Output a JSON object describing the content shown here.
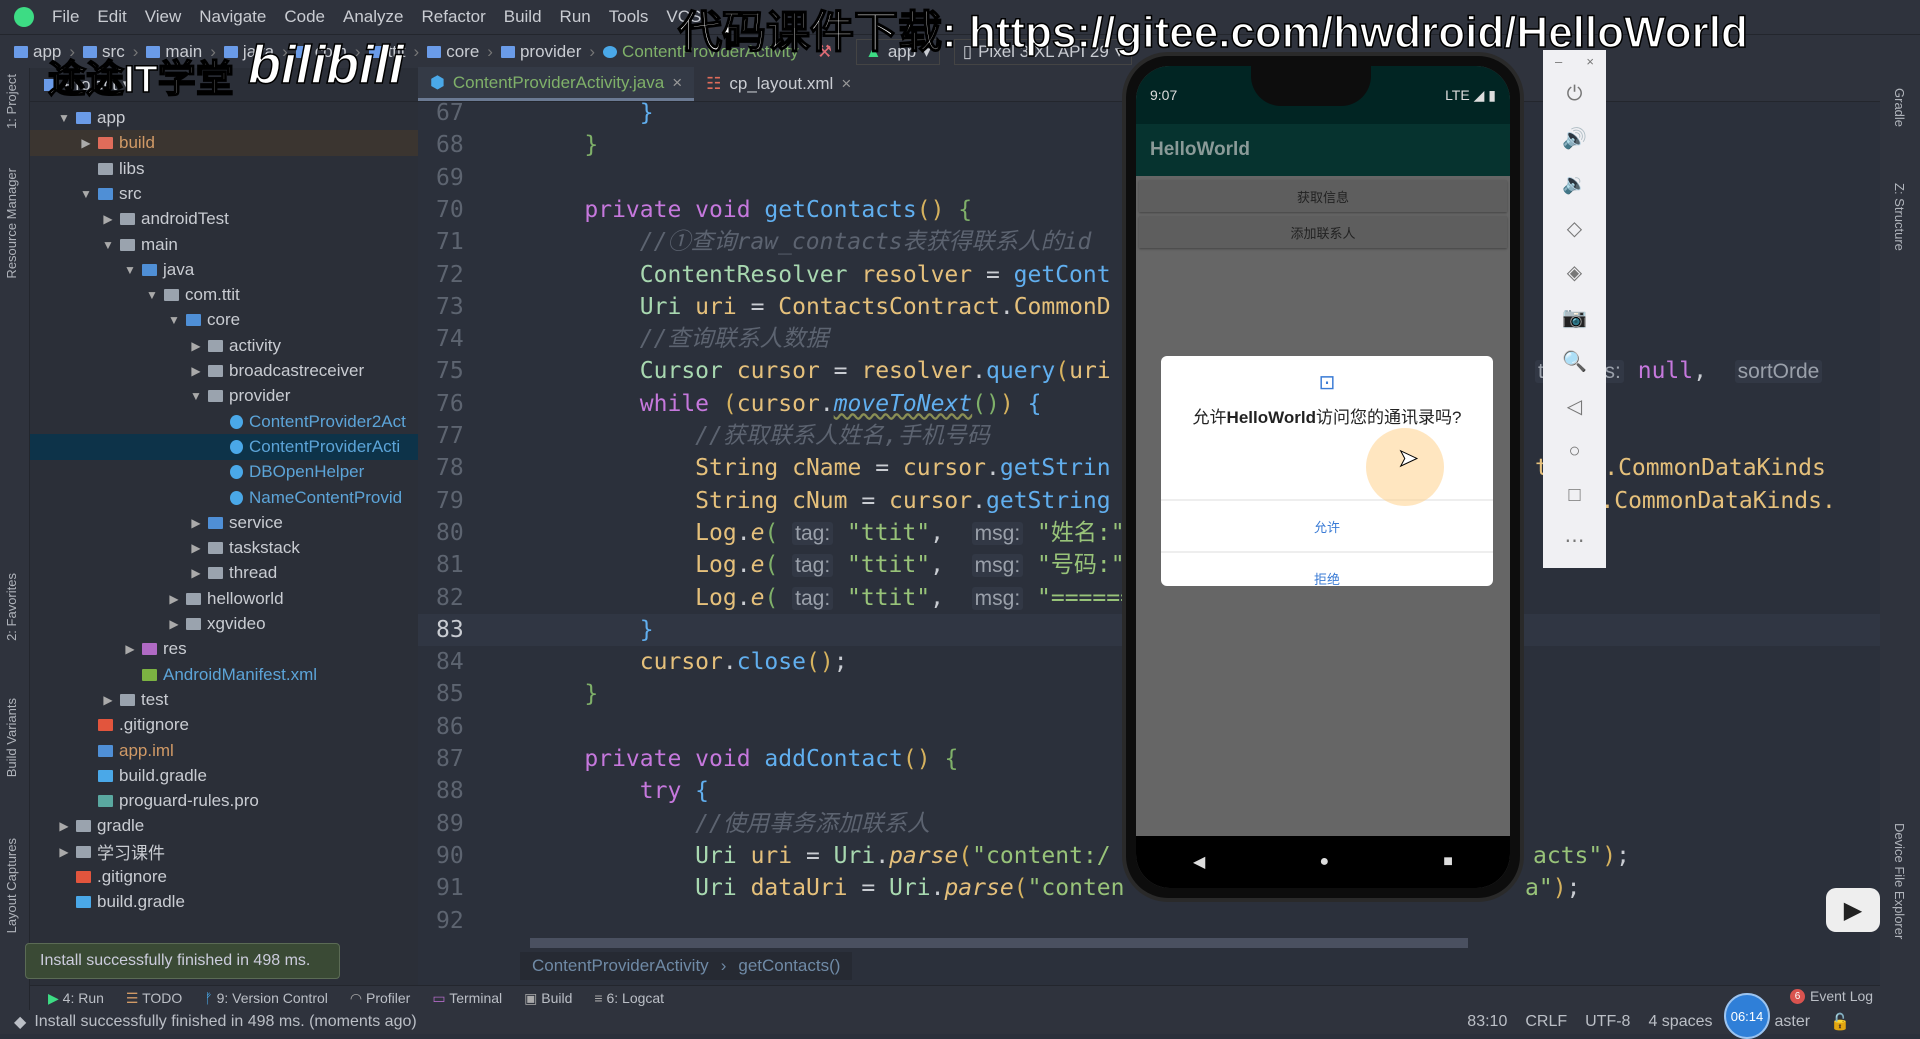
{
  "watermark": {
    "top": "代码课件下载: https://gitee.com/hwdroid/HelloWorld",
    "channel": "途途IT学堂",
    "logo": "bilibili"
  },
  "menu": [
    "File",
    "Edit",
    "View",
    "Navigate",
    "Code",
    "Analyze",
    "Refactor",
    "Build",
    "Run",
    "Tools",
    "VCS"
  ],
  "breadcrumbs": [
    "app",
    "src",
    "main",
    "java",
    "com",
    "ttit",
    "core",
    "provider",
    "ContentProviderActivity"
  ],
  "run_config": "app",
  "device": "Pixel 3 XL API 29",
  "left_strip": [
    "1: Project",
    "Resource Manager",
    "2: Favorites",
    "Build Variants",
    "Layout Captures"
  ],
  "right_strip": [
    "Gradle",
    "Z: Structure",
    "Device File Explorer"
  ],
  "project": {
    "header": "Project",
    "tree": [
      {
        "l": 1,
        "t": "app",
        "o": true,
        "k": "module"
      },
      {
        "l": 2,
        "t": "build",
        "k": "fold-orange",
        "c": "#d19a66",
        "bg": "#3b3530"
      },
      {
        "l": 2,
        "t": "libs",
        "k": "folder",
        "leaf": true
      },
      {
        "l": 2,
        "t": "src",
        "o": true,
        "k": "src"
      },
      {
        "l": 3,
        "t": "androidTest",
        "k": "folder"
      },
      {
        "l": 3,
        "t": "main",
        "o": true,
        "k": "folder"
      },
      {
        "l": 4,
        "t": "java",
        "o": true,
        "k": "src"
      },
      {
        "l": 5,
        "t": "com.ttit",
        "o": true,
        "k": "package"
      },
      {
        "l": 6,
        "t": "core",
        "o": true,
        "k": "src"
      },
      {
        "l": 7,
        "t": "activity",
        "k": "package"
      },
      {
        "l": 7,
        "t": "broadcastreceiver",
        "k": "package"
      },
      {
        "l": 7,
        "t": "provider",
        "o": true,
        "k": "package"
      },
      {
        "l": 8,
        "t": "ContentProvider2Act",
        "k": "file",
        "c": "#5ca4d8",
        "leaf": true
      },
      {
        "l": 8,
        "t": "ContentProviderActi",
        "k": "file",
        "c": "#5ca4d8",
        "leaf": true,
        "bg": "#0d3349"
      },
      {
        "l": 8,
        "t": "DBOpenHelper",
        "k": "file",
        "c": "#5ca4d8",
        "leaf": true
      },
      {
        "l": 8,
        "t": "NameContentProvid",
        "k": "file",
        "c": "#5ca4d8",
        "leaf": true
      },
      {
        "l": 7,
        "t": "service",
        "k": "src"
      },
      {
        "l": 7,
        "t": "taskstack",
        "k": "package"
      },
      {
        "l": 7,
        "t": "thread",
        "k": "package"
      },
      {
        "l": 6,
        "t": "helloworld",
        "k": "package"
      },
      {
        "l": 6,
        "t": "xgvideo",
        "k": "package"
      },
      {
        "l": 4,
        "t": "res",
        "k": "res"
      },
      {
        "l": 4,
        "t": "AndroidManifest.xml",
        "k": "android",
        "c": "#5ca4d8",
        "leaf": true
      },
      {
        "l": 3,
        "t": "test",
        "k": "folder"
      },
      {
        "l": 2,
        "t": ".gitignore",
        "k": "git",
        "leaf": true
      },
      {
        "l": 2,
        "t": "app.iml",
        "k": "iml",
        "c": "#d19a66",
        "leaf": true
      },
      {
        "l": 2,
        "t": "build.gradle",
        "k": "gradle",
        "leaf": true
      },
      {
        "l": 2,
        "t": "proguard-rules.pro",
        "k": "pro",
        "leaf": true
      },
      {
        "l": 1,
        "t": "gradle",
        "k": "folder"
      },
      {
        "l": 1,
        "t": "学习课件",
        "k": "folder"
      },
      {
        "l": 1,
        "t": ".gitignore",
        "k": "git",
        "leaf": true
      },
      {
        "l": 1,
        "t": "build.gradle",
        "k": "gradle",
        "leaf": true
      }
    ]
  },
  "tabs": [
    {
      "label": "ContentProviderActivity.java",
      "active": true
    },
    {
      "label": "cp_layout.xml"
    }
  ],
  "code": {
    "current_line": 83,
    "lines": [
      {
        "n": 67,
        "tk": [
          [
            "pl",
            "        "
          ],
          [
            "bl",
            "}"
          ]
        ]
      },
      {
        "n": 68,
        "tk": [
          [
            "pl",
            "    "
          ],
          [
            "gr",
            "}"
          ]
        ]
      },
      {
        "n": 69,
        "tk": []
      },
      {
        "n": 70,
        "tk": [
          [
            "pl",
            "    "
          ],
          [
            "kw",
            "private void "
          ],
          [
            "fn",
            "getContacts"
          ],
          [
            "ye",
            "()"
          ],
          [
            "pl",
            " "
          ],
          [
            "gr",
            "{"
          ]
        ]
      },
      {
        "n": 71,
        "tk": [
          [
            "pl",
            "        "
          ],
          [
            "cm",
            "//①查询raw_contacts表获得联系人的id"
          ]
        ]
      },
      {
        "n": 72,
        "tk": [
          [
            "pl",
            "        "
          ],
          [
            "ty",
            "ContentResolver "
          ],
          [
            "va",
            "resolver"
          ],
          [
            "pl",
            " = "
          ],
          [
            "fn",
            "getCont"
          ]
        ]
      },
      {
        "n": 73,
        "tk": [
          [
            "pl",
            "        "
          ],
          [
            "ty",
            "Uri "
          ],
          [
            "va",
            "uri"
          ],
          [
            "pl",
            " = "
          ],
          [
            "va",
            "ContactsContract"
          ],
          [
            "pl",
            "."
          ],
          [
            "va",
            "CommonD"
          ]
        ]
      },
      {
        "n": 74,
        "tk": [
          [
            "pl",
            "        "
          ],
          [
            "cm",
            "//查询联系人数据"
          ]
        ]
      },
      {
        "n": 75,
        "tk": [
          [
            "pl",
            "        "
          ],
          [
            "ty",
            "Cursor "
          ],
          [
            "va",
            "cursor"
          ],
          [
            "pl",
            " = "
          ],
          [
            "va",
            "resolver"
          ],
          [
            "pl",
            "."
          ],
          [
            "fn",
            "query"
          ],
          [
            "ye",
            "("
          ],
          [
            "va",
            "uri"
          ]
        ]
      },
      {
        "n": 76,
        "tk": [
          [
            "pl",
            "        "
          ],
          [
            "kw",
            "while "
          ],
          [
            "ye",
            "("
          ],
          [
            "va",
            "cursor"
          ],
          [
            "pl",
            "."
          ],
          [
            "fn it ul",
            "moveToNext"
          ],
          [
            "gr",
            "()"
          ],
          [
            "ye",
            ")"
          ],
          [
            "pl",
            " "
          ],
          [
            "bl",
            "{"
          ]
        ]
      },
      {
        "n": 77,
        "tk": [
          [
            "pl",
            "            "
          ],
          [
            "cm",
            "//获取联系人姓名,手机号码"
          ]
        ]
      },
      {
        "n": 78,
        "tk": [
          [
            "pl",
            "            "
          ],
          [
            "va",
            "String cName"
          ],
          [
            "pl",
            " = "
          ],
          [
            "va",
            "cursor"
          ],
          [
            "pl",
            "."
          ],
          [
            "fn",
            "getStrin"
          ]
        ]
      },
      {
        "n": 79,
        "tk": [
          [
            "pl",
            "            "
          ],
          [
            "va",
            "String cNum"
          ],
          [
            "pl",
            " = "
          ],
          [
            "va",
            "cursor"
          ],
          [
            "pl",
            "."
          ],
          [
            "fn",
            "getString"
          ]
        ]
      },
      {
        "n": 80,
        "tk": [
          [
            "pl",
            "            "
          ],
          [
            "va",
            "Log"
          ],
          [
            "pl",
            "."
          ],
          [
            "va it",
            "e"
          ],
          [
            "gr",
            "( "
          ],
          [
            "hint",
            "tag:"
          ],
          [
            "st",
            " \"ttit\""
          ],
          [
            "pl",
            ",  "
          ],
          [
            "hint",
            "msg:"
          ],
          [
            "st",
            " \"姓名:\""
          ],
          [
            "pl",
            " +"
          ]
        ]
      },
      {
        "n": 81,
        "tk": [
          [
            "pl",
            "            "
          ],
          [
            "va",
            "Log"
          ],
          [
            "pl",
            "."
          ],
          [
            "va it",
            "e"
          ],
          [
            "gr",
            "( "
          ],
          [
            "hint",
            "tag:"
          ],
          [
            "st",
            " \"ttit\""
          ],
          [
            "pl",
            ",  "
          ],
          [
            "hint",
            "msg:"
          ],
          [
            "st",
            " \"号码:\""
          ],
          [
            "pl",
            " +"
          ]
        ]
      },
      {
        "n": 82,
        "tk": [
          [
            "pl",
            "            "
          ],
          [
            "va",
            "Log"
          ],
          [
            "pl",
            "."
          ],
          [
            "va it",
            "e"
          ],
          [
            "gr",
            "( "
          ],
          [
            "hint",
            "tag:"
          ],
          [
            "st",
            " \"ttit\""
          ],
          [
            "pl",
            ",  "
          ],
          [
            "hint",
            "msg:"
          ],
          [
            "st",
            " \"======="
          ]
        ]
      },
      {
        "n": 83,
        "tk": [
          [
            "pl",
            "        "
          ],
          [
            "bl",
            "}"
          ]
        ]
      },
      {
        "n": 84,
        "tk": [
          [
            "pl",
            "        "
          ],
          [
            "va",
            "cursor"
          ],
          [
            "pl",
            "."
          ],
          [
            "fn",
            "close"
          ],
          [
            "ye",
            "()"
          ],
          [
            "pl",
            ";"
          ]
        ]
      },
      {
        "n": 85,
        "tk": [
          [
            "pl",
            "    "
          ],
          [
            "gr",
            "}"
          ]
        ]
      },
      {
        "n": 86,
        "tk": []
      },
      {
        "n": 87,
        "tk": [
          [
            "pl",
            "    "
          ],
          [
            "kw",
            "private void "
          ],
          [
            "fn",
            "addContact"
          ],
          [
            "ye",
            "()"
          ],
          [
            "pl",
            " "
          ],
          [
            "gr",
            "{"
          ]
        ]
      },
      {
        "n": 88,
        "tk": [
          [
            "pl",
            "        "
          ],
          [
            "kw",
            "try "
          ],
          [
            "bl",
            "{"
          ]
        ]
      },
      {
        "n": 89,
        "tk": [
          [
            "pl",
            "            "
          ],
          [
            "cm",
            "//使用事务添加联系人"
          ]
        ]
      },
      {
        "n": 90,
        "tk": [
          [
            "pl",
            "            "
          ],
          [
            "ty",
            "Uri "
          ],
          [
            "va",
            "uri"
          ],
          [
            "pl",
            " = "
          ],
          [
            "ty",
            "Uri"
          ],
          [
            "pl",
            "."
          ],
          [
            "va it",
            "parse"
          ],
          [
            "ye",
            "("
          ],
          [
            "st",
            "\"content:/"
          ]
        ]
      },
      {
        "n": 91,
        "tk": [
          [
            "pl",
            "            "
          ],
          [
            "ty",
            "Uri "
          ],
          [
            "va",
            "dataUri"
          ],
          [
            "pl",
            " = "
          ],
          [
            "ty",
            "Uri"
          ],
          [
            "pl",
            "."
          ],
          [
            "va it",
            "parse"
          ],
          [
            "ye",
            "("
          ],
          [
            "st",
            "\"conten"
          ]
        ]
      },
      {
        "n": 92,
        "tk": []
      }
    ],
    "right_fragments": [
      {
        "n": 75,
        "tk": [
          [
            "hint",
            "tionArgs:"
          ],
          [
            "kw",
            " null"
          ],
          [
            "pl",
            ",  "
          ],
          [
            "hint",
            "sortOrde"
          ]
        ]
      },
      {
        "n": 78,
        "tk": [
          [
            "va",
            "tract.CommonDataKinds"
          ]
        ]
      },
      {
        "n": 79,
        "tk": [
          [
            "va",
            "ract.CommonDataKinds."
          ]
        ]
      },
      {
        "n": 90,
        "tk": [
          [
            "st",
            "acts\""
          ],
          [
            "ye",
            ")"
          ],
          [
            "pl",
            ";"
          ]
        ]
      },
      {
        "n": 91,
        "tk": [
          [
            "st",
            "a\""
          ],
          [
            "ye",
            ")"
          ],
          [
            "pl",
            ";"
          ]
        ]
      }
    ]
  },
  "editor_breadcrumb": [
    "ContentProviderActivity",
    "getContacts()"
  ],
  "phone": {
    "time": "9:07",
    "network": "LTE",
    "app_title": "HelloWorld",
    "buttons": [
      "获取信息",
      "添加联系人"
    ],
    "dialog": {
      "pre": "允许",
      "app": "HelloWorld",
      "post": "访问您的通讯录吗?",
      "allow": "允许",
      "deny": "拒绝",
      "accent": "#3a7bd5"
    }
  },
  "emulator_toolbar": [
    "power",
    "volume-up",
    "volume-down",
    "rotate-left",
    "rotate-right",
    "screenshot",
    "zoom",
    "back",
    "home",
    "overview",
    "more"
  ],
  "toast": "Install successfully finished in 498 ms.",
  "tool_windows": [
    "4: Run",
    "TODO",
    "9: Version Control",
    "Profiler",
    "Terminal",
    "Build",
    "6: Logcat"
  ],
  "event_log": {
    "label": "Event Log",
    "count": "6"
  },
  "status": {
    "message": "Install successfully finished in 498 ms. (moments ago)",
    "position": "83:10",
    "line_sep": "CRLF",
    "encoding": "UTF-8",
    "indent": "4 spaces",
    "branch": "aster",
    "clock": "06:14"
  }
}
